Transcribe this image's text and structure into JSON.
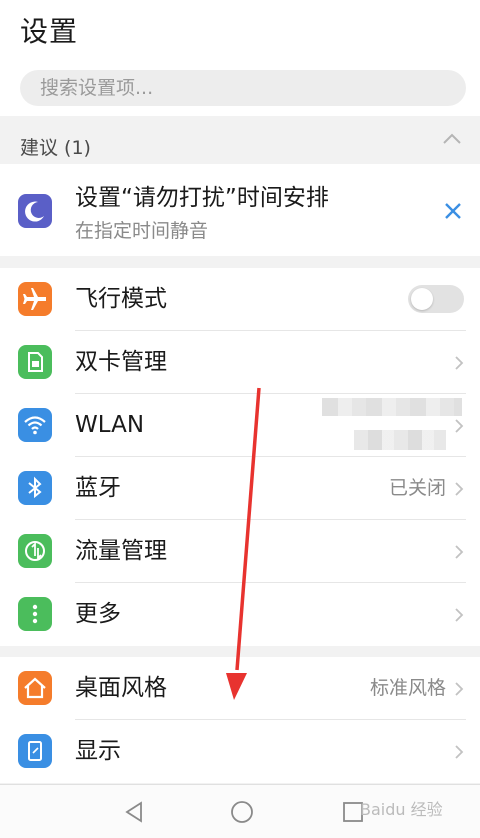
{
  "header": {
    "title": "设置"
  },
  "search": {
    "placeholder": "搜索设置项..."
  },
  "suggestions": {
    "title": "建议 (1)",
    "card": {
      "title": "设置“请勿打扰”时间安排",
      "subtitle": "在指定时间静音"
    }
  },
  "groups": [
    {
      "items": [
        {
          "label": "飞行模式",
          "icon": "airplane-icon",
          "color": "#f57c2b",
          "control": "toggle",
          "state": "off"
        },
        {
          "label": "双卡管理",
          "icon": "sim-card-icon",
          "color": "#4bbd5c"
        },
        {
          "label": "WLAN",
          "icon": "wifi-icon",
          "color": "#3a8fe3"
        },
        {
          "label": "蓝牙",
          "value": "已关闭",
          "icon": "bluetooth-icon",
          "color": "#3a8fe3"
        },
        {
          "label": "流量管理",
          "icon": "data-usage-icon",
          "color": "#4bbd5c"
        },
        {
          "label": "更多",
          "icon": "more-icon",
          "color": "#4bbd5c"
        }
      ]
    },
    {
      "items": [
        {
          "label": "桌面风格",
          "value": "标准风格",
          "icon": "home-icon",
          "color": "#f57c2b"
        },
        {
          "label": "显示",
          "icon": "display-icon",
          "color": "#3a8fe3"
        }
      ]
    }
  ],
  "navbar": [
    "back-icon",
    "home-circle-icon",
    "recents-icon"
  ],
  "watermark": "Baidu 经验",
  "colors": {
    "accent": "#3a8fe3",
    "annotation_arrow": "#e8332f"
  }
}
